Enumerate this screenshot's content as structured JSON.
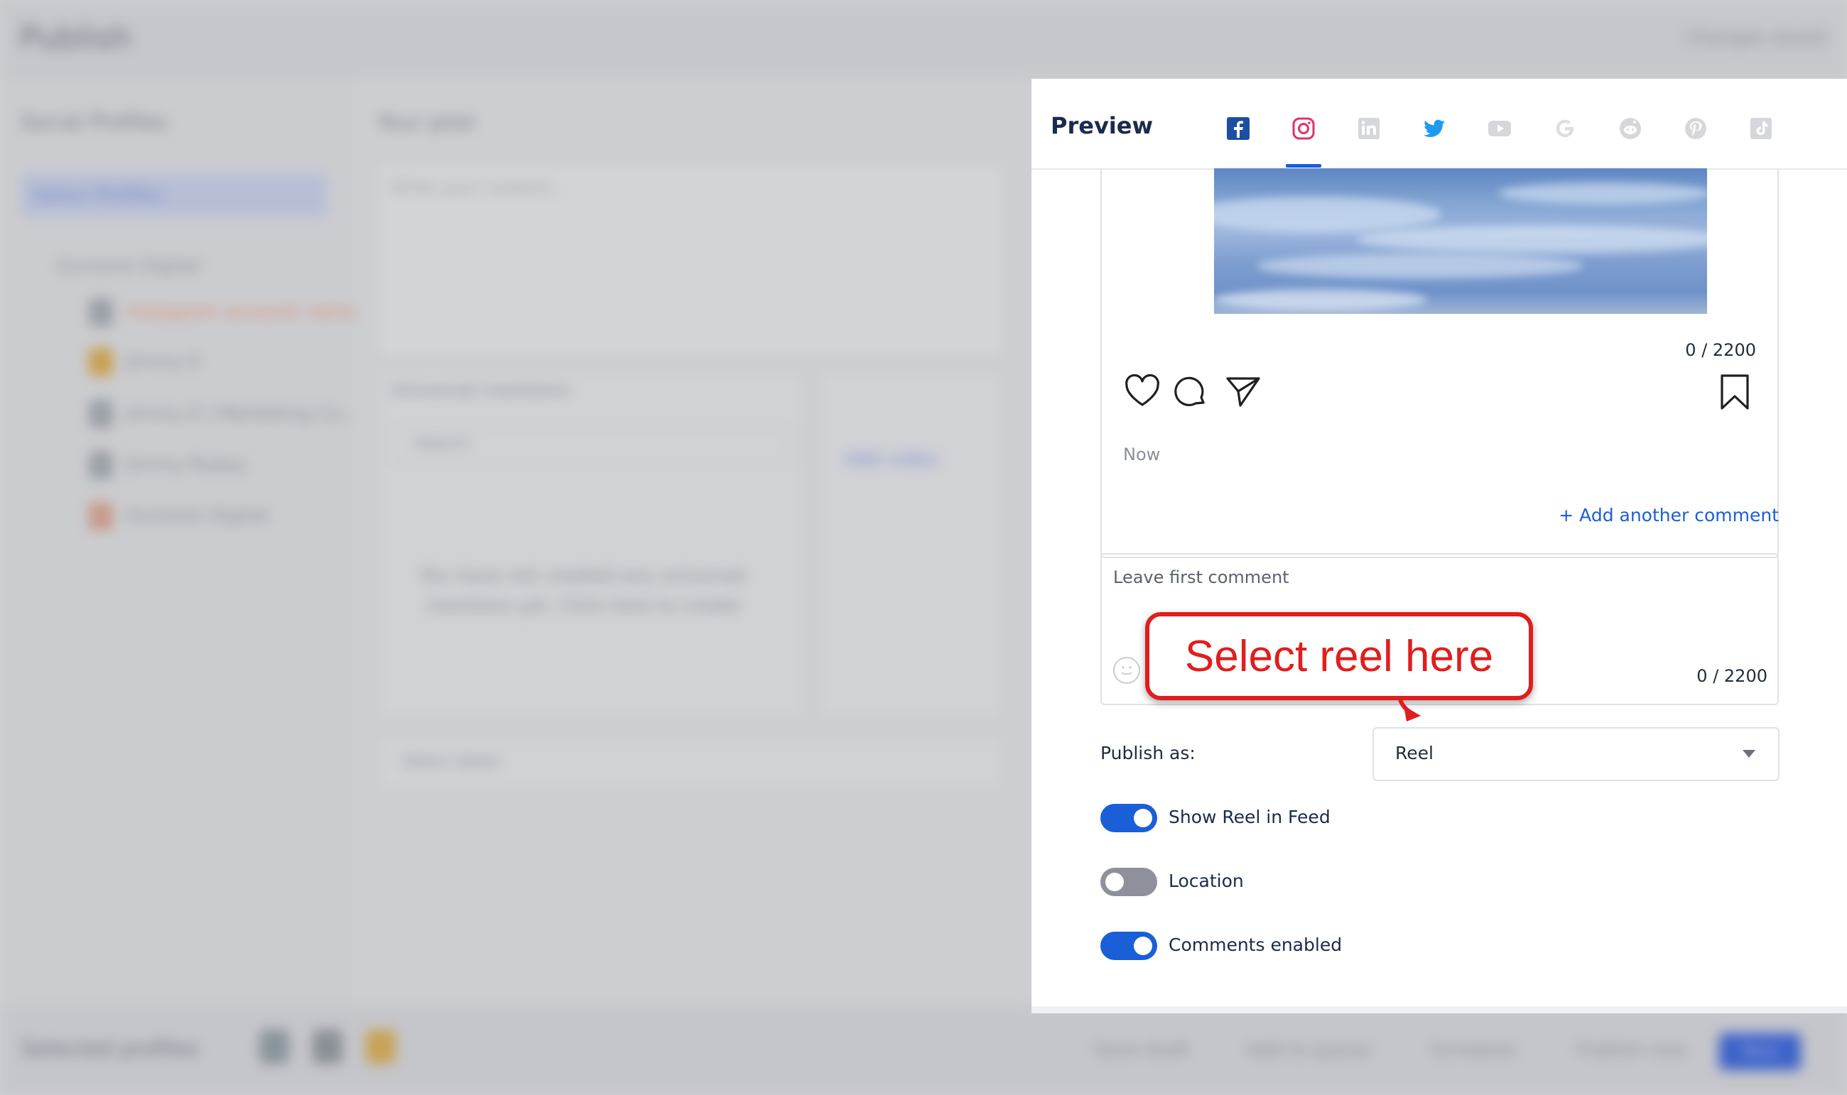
{
  "background": {
    "header": {
      "title": "Publish",
      "changes": "Changes saved"
    },
    "sidebar": {
      "title": "Social Profiles",
      "select_label": "Select Profiles",
      "group": "Gumonk Digital",
      "profiles": [
        "Instagram account name",
        "Jimmy E",
        "Jimmy E | Marketing Co...",
        "Jimmy Rubey",
        "Gumonk Digital"
      ]
    },
    "post": {
      "title": "Your post",
      "placeholder": "Write your content...",
      "mentions_title": "Universal mentions",
      "search_placeholder": "Search",
      "empty_line1": "You have not created any universal",
      "empty_line2": "mentions yet. Click here to create",
      "add_video": "Add video",
      "labels_placeholder": "Select labels"
    },
    "footer": {
      "label": "Selected profiles",
      "save_draft": "Save draft",
      "add_to_queue": "Add to queue",
      "schedule": "Schedule",
      "publish_now": "Publish now",
      "send": "Next"
    }
  },
  "preview": {
    "title": "Preview",
    "platform_icons": [
      "facebook-icon",
      "instagram-icon",
      "linkedin-icon",
      "twitter-icon",
      "youtube-icon",
      "google-icon",
      "reddit-icon",
      "pinterest-icon",
      "tiktok-icon"
    ],
    "active_platform": "instagram-icon",
    "caption_counter": "0 / 2200",
    "timestamp": "Now",
    "add_comment_label": "+ Add another comment",
    "comment_placeholder": "Leave first comment",
    "comment_counter": "0 / 2200",
    "publish_as_label": "Publish as:",
    "publish_as_value": "Reel",
    "toggles": [
      {
        "label": "Show Reel in Feed",
        "state": "on"
      },
      {
        "label": "Location",
        "state": "off"
      },
      {
        "label": "Comments enabled",
        "state": "on"
      }
    ]
  },
  "callout": {
    "text": "Select reel here"
  },
  "colors": {
    "accent": "#1a5ed8",
    "callout": "#e11d1d",
    "instagram": "#e1306c",
    "twitter": "#1d9bf0",
    "facebook": "#1b4fa3"
  }
}
